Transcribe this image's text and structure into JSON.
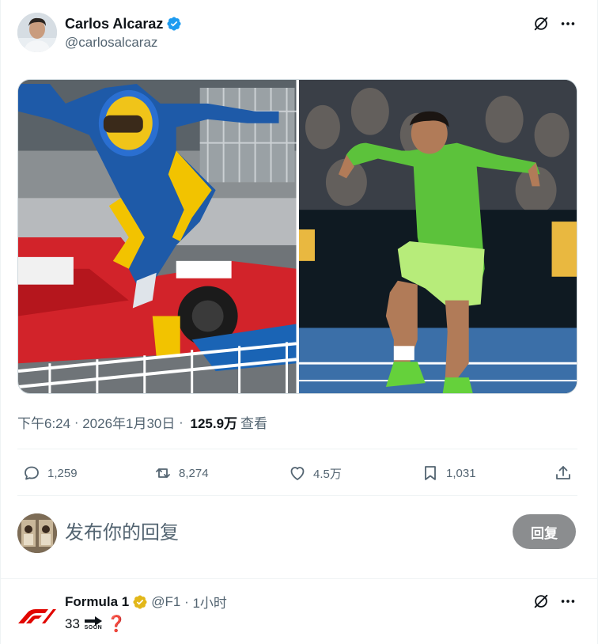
{
  "tweet": {
    "author": {
      "name": "Carlos Alcaraz",
      "handle": "@carlosalcaraz",
      "verified_color": "#1d9bf0"
    },
    "media": [
      {
        "subject": "racing driver jumping from car"
      },
      {
        "subject": "tennis player jumping celebration"
      }
    ],
    "meta": {
      "time": "下午6:24",
      "separator": " · ",
      "date": "2026年1月30日",
      "separator2": " · ",
      "views_count": "125.9万",
      "views_label": "查看"
    },
    "actions": {
      "replies": "1,259",
      "retweets": "8,274",
      "likes": "4.5万",
      "bookmarks": "1,031"
    }
  },
  "reply_box": {
    "placeholder": "发布你的回复",
    "button_label": "回复",
    "button_color": "#8b8d8f"
  },
  "next_tweet": {
    "name": "Formula 1",
    "handle": "@F1",
    "separator": " · ",
    "time": "1小时",
    "body_number": "33",
    "soon_label": "SOON",
    "question_mark": "❓",
    "brand_color": "#e10600",
    "badge_color": "#e2b719"
  },
  "icons": {
    "grok": "grok-icon",
    "more": "more-icon",
    "reply": "reply-icon",
    "retweet": "retweet-icon",
    "like": "heart-icon",
    "bookmark": "bookmark-icon",
    "share": "share-icon"
  }
}
